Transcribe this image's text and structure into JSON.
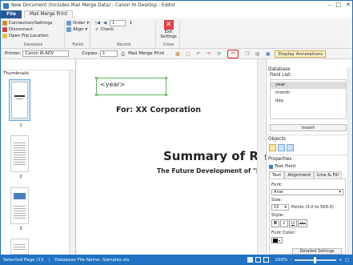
{
  "window": {
    "title": "New Document (Includes Mail Merge Data) - Canon Hi Desktop - Editor"
  },
  "tabs": {
    "file": "File",
    "mail_merge_print": "Mail Merge Print"
  },
  "ribbon": {
    "database": {
      "connection": "Connection/Settings",
      "disconnect": "Disconnect",
      "open_file_location": "Open File Location",
      "caption": "Database"
    },
    "fields": {
      "order": "Order",
      "align": "Align",
      "caption": "Fields"
    },
    "record": {
      "value": "1",
      "check": "Check",
      "caption": "Record"
    },
    "close": {
      "exit_label": "Exit Settings",
      "caption": "Close"
    }
  },
  "toolbar": {
    "printer_label": "Printer:",
    "printer_value": "Canon iR-ADV",
    "copies_label": "Copies:",
    "copies_value": "1",
    "mm_print": "Mail Merge Print",
    "display_annotations": "Display Annotations"
  },
  "left_pane": {
    "thumbnails_label": "Thumbnails",
    "pages": [
      "1",
      "2",
      "3"
    ]
  },
  "document": {
    "year_field": "<year>",
    "for_line": "For: XX Corporation",
    "summary": "Summary of Rese",
    "subtitle": "The Future Development of \"DE LA C"
  },
  "right_pane": {
    "database_label": "Database",
    "field_list_label": "Field List:",
    "fields": [
      "year",
      "month",
      "day"
    ],
    "insert_button": "Insert",
    "objects_label": "Objects",
    "properties_label": "Properties",
    "object_type": "Text Field",
    "prop_tabs": [
      "Text",
      "Alignment",
      "Line & Fill"
    ],
    "font_label": "Font:",
    "font_value": "Arial",
    "size_label": "Size:",
    "size_value": "15",
    "size_hint": "Points (3.0 to 500.0)",
    "style_label": "Style:",
    "style_bold": "B",
    "style_italic": "I",
    "style_underline": "U",
    "style_strike": "abc",
    "font_color_label": "Font Color:",
    "detailed_settings": "Detailed Settings"
  },
  "status": {
    "selected_page": "Selected Page /13",
    "db_file": "Database File Name: Samples.xls",
    "zoom": "100%"
  }
}
